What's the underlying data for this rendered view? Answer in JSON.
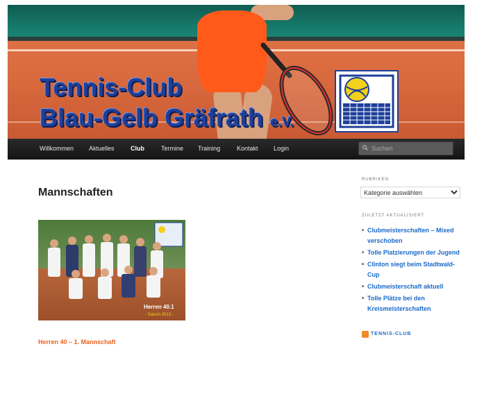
{
  "header": {
    "title_line1": "Tennis-Club",
    "title_line2": "Blau-Gelb Gräfrath",
    "title_suffix": "e.V."
  },
  "nav": {
    "items": [
      {
        "label": "Willkommen",
        "active": false
      },
      {
        "label": "Aktuelles",
        "active": false
      },
      {
        "label": "Club",
        "active": true
      },
      {
        "label": "Termine",
        "active": false
      },
      {
        "label": "Training",
        "active": false
      },
      {
        "label": "Kontakt",
        "active": false
      },
      {
        "label": "Login",
        "active": false
      }
    ]
  },
  "search": {
    "placeholder": "Suchen",
    "icon": "search-icon"
  },
  "main": {
    "page_title": "Mannschaften",
    "photo": {
      "label_line1": "Herren 40.1",
      "label_line2": "- Saison 2013 -"
    },
    "caption": "Herren 40 – 1. Mannschaft"
  },
  "sidebar": {
    "categories_heading": "RUBRIKEN",
    "categories_select": "Kategorie auswählen",
    "recent_heading": "ZULETZT AKTUALISIERT",
    "recent_items": [
      "Clubmeisterschaften – Mixed verschoben",
      "Tolle Platzierungen der Jugend",
      "Clinton siegt beim Stadtwald-Cup",
      "Clubmeisterschaft aktuell",
      "Tolle Plätze bei den Kreismeisterschaften"
    ],
    "rss_label": "TENNIS-CLUB"
  },
  "colors": {
    "accent_orange": "#e9621f",
    "link_blue": "#1b6ac9",
    "nav_bg": "#1a1a1a",
    "logo_blue": "#1e3f9a",
    "logo_yellow": "#f2d21a"
  }
}
